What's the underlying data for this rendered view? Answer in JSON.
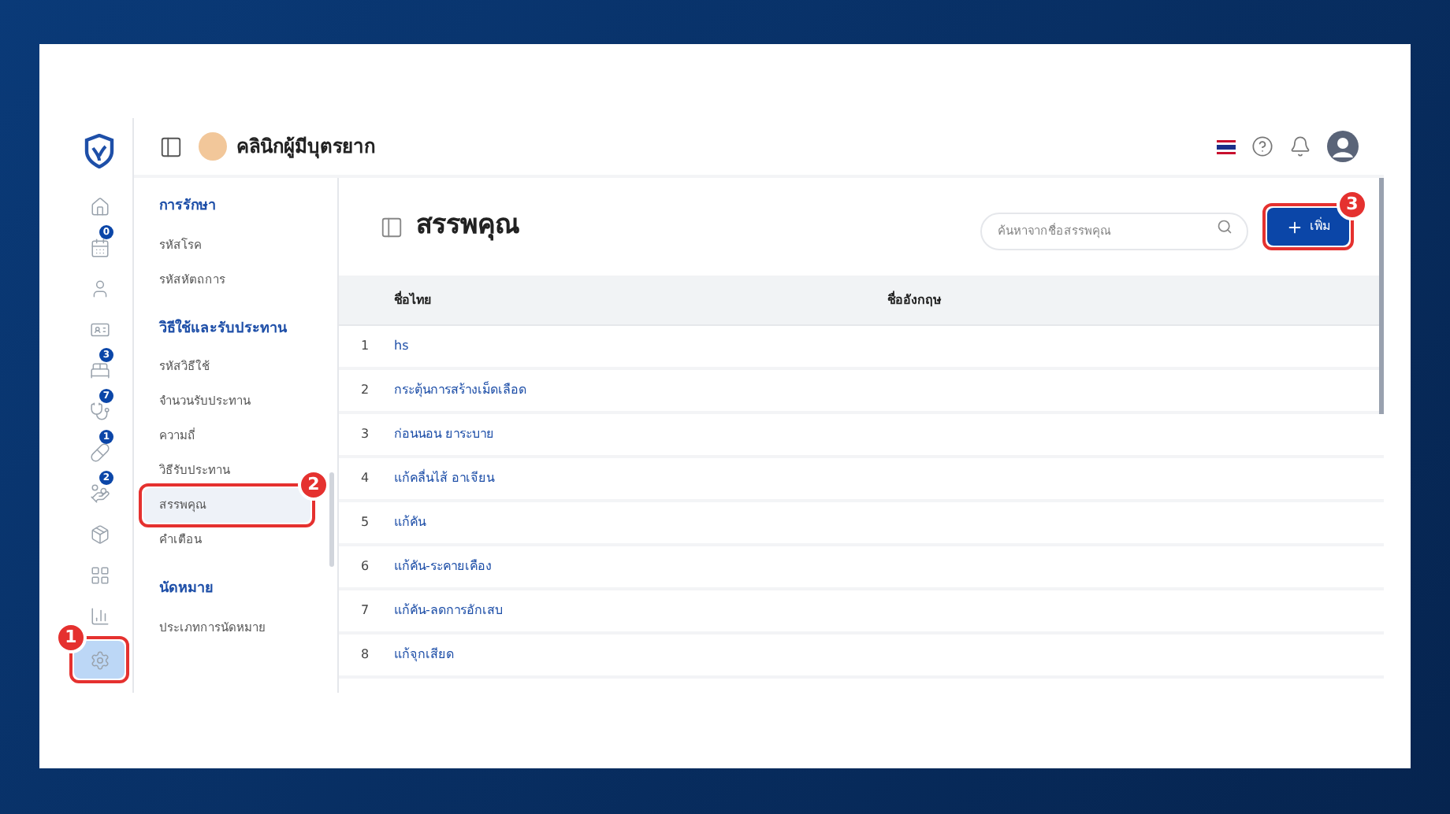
{
  "header": {
    "clinic_name": "คลินิกผู้มีบุตรยาก"
  },
  "rail": [
    {
      "kind": "home",
      "selected": false
    },
    {
      "kind": "calendar",
      "badge": "0",
      "selected": false
    },
    {
      "kind": "user",
      "selected": false
    },
    {
      "kind": "card",
      "selected": false
    },
    {
      "kind": "bed",
      "badge": "3",
      "selected": false
    },
    {
      "kind": "stethoscope",
      "badge": "7",
      "selected": false
    },
    {
      "kind": "pill",
      "badge": "1",
      "selected": false
    },
    {
      "kind": "hand",
      "badge": "2",
      "selected": false
    },
    {
      "kind": "package",
      "selected": false
    },
    {
      "kind": "grid",
      "selected": false
    },
    {
      "kind": "chart",
      "selected": false
    },
    {
      "kind": "settings",
      "selected": true,
      "callout": "1"
    }
  ],
  "submenu": [
    {
      "heading": "การรักษา",
      "items": [
        {
          "label": "รหัสโรค",
          "selected": false
        },
        {
          "label": "รหัสหัตถการ",
          "selected": false
        }
      ]
    },
    {
      "heading": "วิธีใช้และรับประทาน",
      "items": [
        {
          "label": "รหัสวิธีใช้",
          "selected": false
        },
        {
          "label": "จำนวนรับประทาน",
          "selected": false
        },
        {
          "label": "ความถี่",
          "selected": false
        },
        {
          "label": "วิธีรับประทาน",
          "selected": false
        },
        {
          "label": "สรรพคุณ",
          "selected": true,
          "callout": "2"
        },
        {
          "label": "คำเตือน",
          "selected": false
        }
      ]
    },
    {
      "heading": "นัดหมาย",
      "items": [
        {
          "label": "ประเภทการนัดหมาย",
          "selected": false
        }
      ]
    }
  ],
  "page": {
    "title": "สรรพคุณ",
    "search": {
      "placeholder": "ค้นหาจากชื่อสรรพคุณ"
    },
    "add_button": {
      "label": "เพิ่ม",
      "callout": "3"
    }
  },
  "table": {
    "columns": [
      "ชื่อไทย",
      "ชื่ออังกฤษ"
    ],
    "rows": [
      {
        "index": "1",
        "thai_name": "hs"
      },
      {
        "index": "2",
        "thai_name": "กระตุ้นการสร้างเม็ดเลือด"
      },
      {
        "index": "3",
        "thai_name": "ก่อนนอน ยาระบาย"
      },
      {
        "index": "4",
        "thai_name": "แก้คลื่นไส้ อาเจียน"
      },
      {
        "index": "5",
        "thai_name": "แก้คัน"
      },
      {
        "index": "6",
        "thai_name": "แก้คัน-ระคายเคือง"
      },
      {
        "index": "7",
        "thai_name": "แก้คัน-ลดการอักเสบ"
      },
      {
        "index": "8",
        "thai_name": "แก้จุกเสียด"
      }
    ]
  }
}
